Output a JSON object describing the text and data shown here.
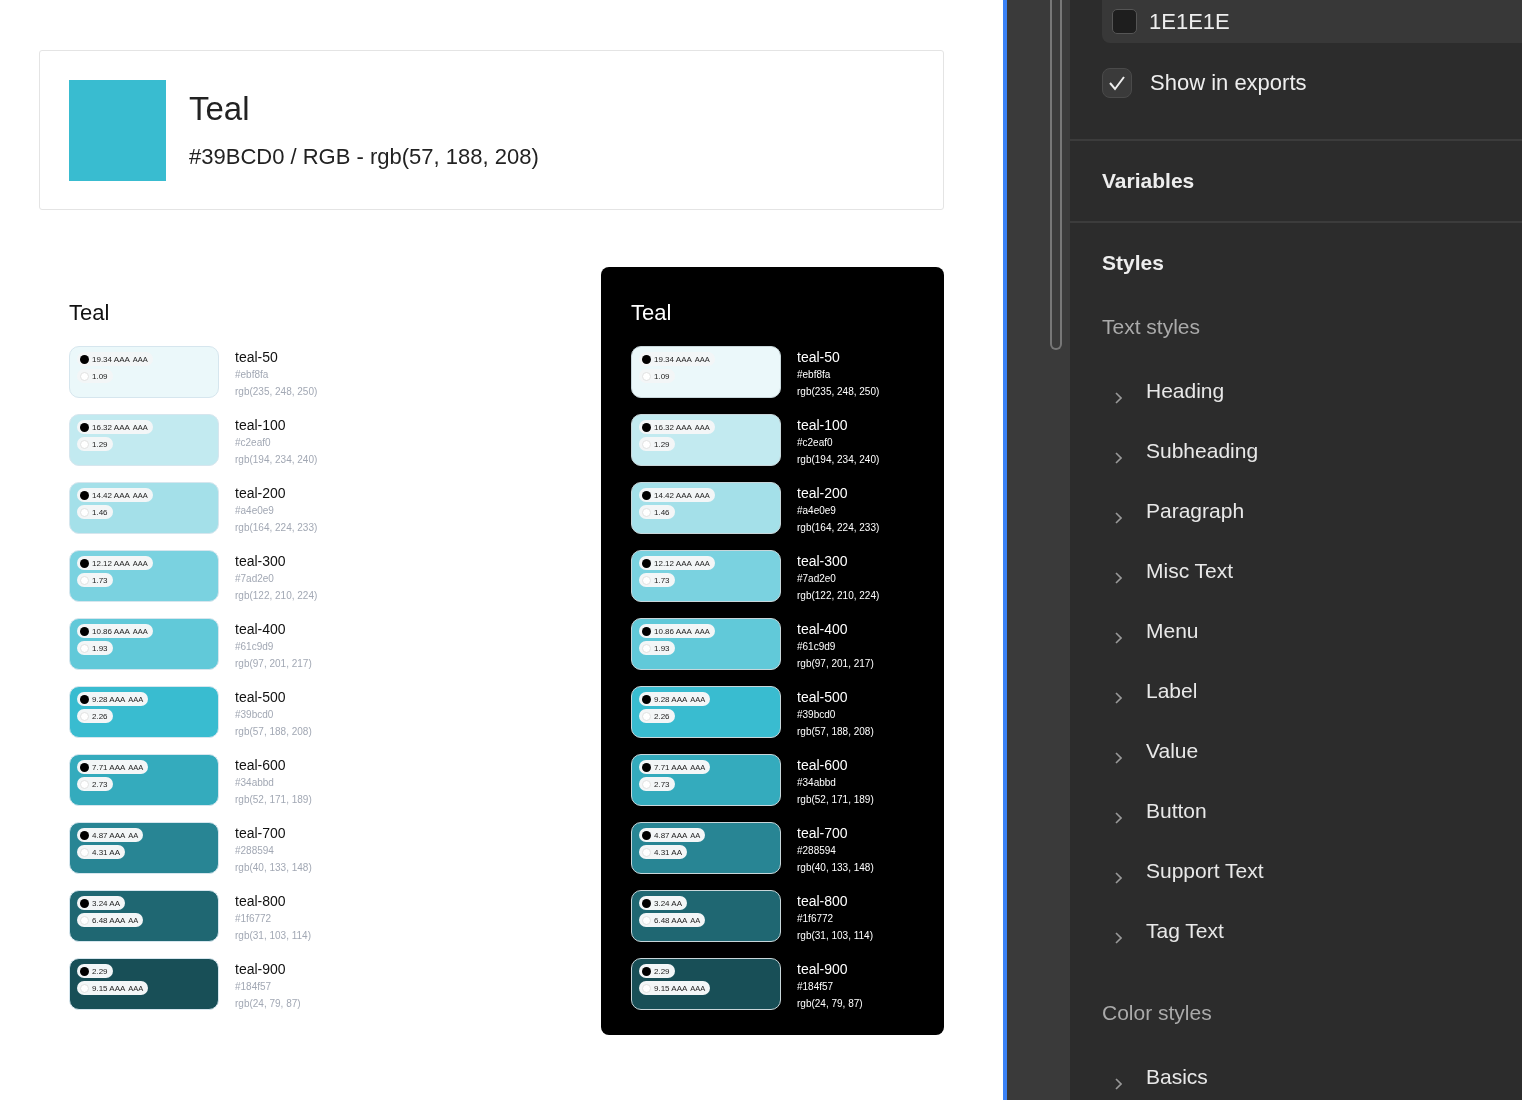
{
  "header_card": {
    "name": "Teal",
    "color": "#39bcd0",
    "subtitle": "#39BCD0 / RGB - rgb(57, 188, 208)"
  },
  "light_panel": {
    "title": "Teal",
    "swatches": [
      {
        "name": "teal-50",
        "hex": "#ebf8fa",
        "rgb": "rgb(235, 248, 250)",
        "color": "#ebf8fa",
        "on_black": {
          "text": "19.34 AAA",
          "small": "AAA"
        },
        "on_white": {
          "text": "1.09"
        }
      },
      {
        "name": "teal-100",
        "hex": "#c2eaf0",
        "rgb": "rgb(194, 234, 240)",
        "color": "#c2eaf0",
        "on_black": {
          "text": "16.32 AAA",
          "small": "AAA"
        },
        "on_white": {
          "text": "1.29"
        }
      },
      {
        "name": "teal-200",
        "hex": "#a4e0e9",
        "rgb": "rgb(164, 224, 233)",
        "color": "#a4e0e9",
        "on_black": {
          "text": "14.42 AAA",
          "small": "AAA"
        },
        "on_white": {
          "text": "1.46"
        }
      },
      {
        "name": "teal-300",
        "hex": "#7ad2e0",
        "rgb": "rgb(122, 210, 224)",
        "color": "#7ad2e0",
        "on_black": {
          "text": "12.12 AAA",
          "small": "AAA"
        },
        "on_white": {
          "text": "1.73"
        }
      },
      {
        "name": "teal-400",
        "hex": "#61c9d9",
        "rgb": "rgb(97, 201, 217)",
        "color": "#61c9d9",
        "on_black": {
          "text": "10.86 AAA",
          "small": "AAA"
        },
        "on_white": {
          "text": "1.93"
        }
      },
      {
        "name": "teal-500",
        "hex": "#39bcd0",
        "rgb": "rgb(57, 188, 208)",
        "color": "#39bcd0",
        "on_black": {
          "text": "9.28 AAA",
          "small": "AAA"
        },
        "on_white": {
          "text": "2.26"
        }
      },
      {
        "name": "teal-600",
        "hex": "#34abbd",
        "rgb": "rgb(52, 171, 189)",
        "color": "#34abbd",
        "on_black": {
          "text": "7.71 AAA",
          "small": "AAA"
        },
        "on_white": {
          "text": "2.73"
        }
      },
      {
        "name": "teal-700",
        "hex": "#288594",
        "rgb": "rgb(40, 133, 148)",
        "color": "#288594",
        "on_black": {
          "text": "4.87 AAA",
          "small": "AA"
        },
        "on_white": {
          "text": "4.31 AA"
        }
      },
      {
        "name": "teal-800",
        "hex": "#1f6772",
        "rgb": "rgb(31, 103, 114)",
        "color": "#1f6772",
        "on_black": {
          "text": "3.24 AA"
        },
        "on_white": {
          "text": "6.48 AAA",
          "small": "AA"
        }
      },
      {
        "name": "teal-900",
        "hex": "#184f57",
        "rgb": "rgb(24, 79, 87)",
        "color": "#184f57",
        "on_black": {
          "text": "2.29"
        },
        "on_white": {
          "text": "9.15 AAA",
          "small": "AAA"
        }
      }
    ]
  },
  "dark_panel": {
    "title": "Teal",
    "swatches": [
      {
        "name": "teal-50",
        "hex": "#ebf8fa",
        "rgb": "rgb(235, 248, 250)",
        "color": "#ebf8fa",
        "on_black": {
          "text": "19.34 AAA",
          "small": "AAA"
        },
        "on_white": {
          "text": "1.09"
        }
      },
      {
        "name": "teal-100",
        "hex": "#c2eaf0",
        "rgb": "rgb(194, 234, 240)",
        "color": "#c2eaf0",
        "on_black": {
          "text": "16.32 AAA",
          "small": "AAA"
        },
        "on_white": {
          "text": "1.29"
        }
      },
      {
        "name": "teal-200",
        "hex": "#a4e0e9",
        "rgb": "rgb(164, 224, 233)",
        "color": "#a4e0e9",
        "on_black": {
          "text": "14.42 AAA",
          "small": "AAA"
        },
        "on_white": {
          "text": "1.46"
        }
      },
      {
        "name": "teal-300",
        "hex": "#7ad2e0",
        "rgb": "rgb(122, 210, 224)",
        "color": "#7ad2e0",
        "on_black": {
          "text": "12.12 AAA",
          "small": "AAA"
        },
        "on_white": {
          "text": "1.73"
        }
      },
      {
        "name": "teal-400",
        "hex": "#61c9d9",
        "rgb": "rgb(97, 201, 217)",
        "color": "#61c9d9",
        "on_black": {
          "text": "10.86 AAA",
          "small": "AAA"
        },
        "on_white": {
          "text": "1.93"
        }
      },
      {
        "name": "teal-500",
        "hex": "#39bcd0",
        "rgb": "rgb(57, 188, 208)",
        "color": "#39bcd0",
        "on_black": {
          "text": "9.28 AAA",
          "small": "AAA"
        },
        "on_white": {
          "text": "2.26"
        }
      },
      {
        "name": "teal-600",
        "hex": "#34abbd",
        "rgb": "rgb(52, 171, 189)",
        "color": "#34abbd",
        "on_black": {
          "text": "7.71 AAA",
          "small": "AAA"
        },
        "on_white": {
          "text": "2.73"
        }
      },
      {
        "name": "teal-700",
        "hex": "#288594",
        "rgb": "rgb(40, 133, 148)",
        "color": "#288594",
        "on_black": {
          "text": "4.87 AAA",
          "small": "AA"
        },
        "on_white": {
          "text": "4.31 AA"
        }
      },
      {
        "name": "teal-800",
        "hex": "#1f6772",
        "rgb": "rgb(31, 103, 114)",
        "color": "#1f6772",
        "on_black": {
          "text": "3.24 AA"
        },
        "on_white": {
          "text": "6.48 AAA",
          "small": "AA"
        }
      },
      {
        "name": "teal-900",
        "hex": "#184f57",
        "rgb": "rgb(24, 79, 87)",
        "color": "#184f57",
        "on_black": {
          "text": "2.29"
        },
        "on_white": {
          "text": "9.15 AAA",
          "small": "AAA"
        }
      }
    ]
  },
  "sidebar": {
    "color_field": {
      "value": "1E1E1E",
      "color": "#1e1e1e"
    },
    "show_in_exports": {
      "label": "Show in exports",
      "checked": true
    },
    "sections": [
      "Variables",
      "Styles"
    ],
    "text_styles": {
      "title": "Text styles",
      "items": [
        "Heading",
        "Subheading",
        "Paragraph",
        "Misc Text",
        "Menu",
        "Label",
        "Value",
        "Button",
        "Support Text",
        "Tag Text"
      ]
    },
    "color_styles": {
      "title": "Color styles",
      "items": [
        "Basics"
      ]
    }
  }
}
